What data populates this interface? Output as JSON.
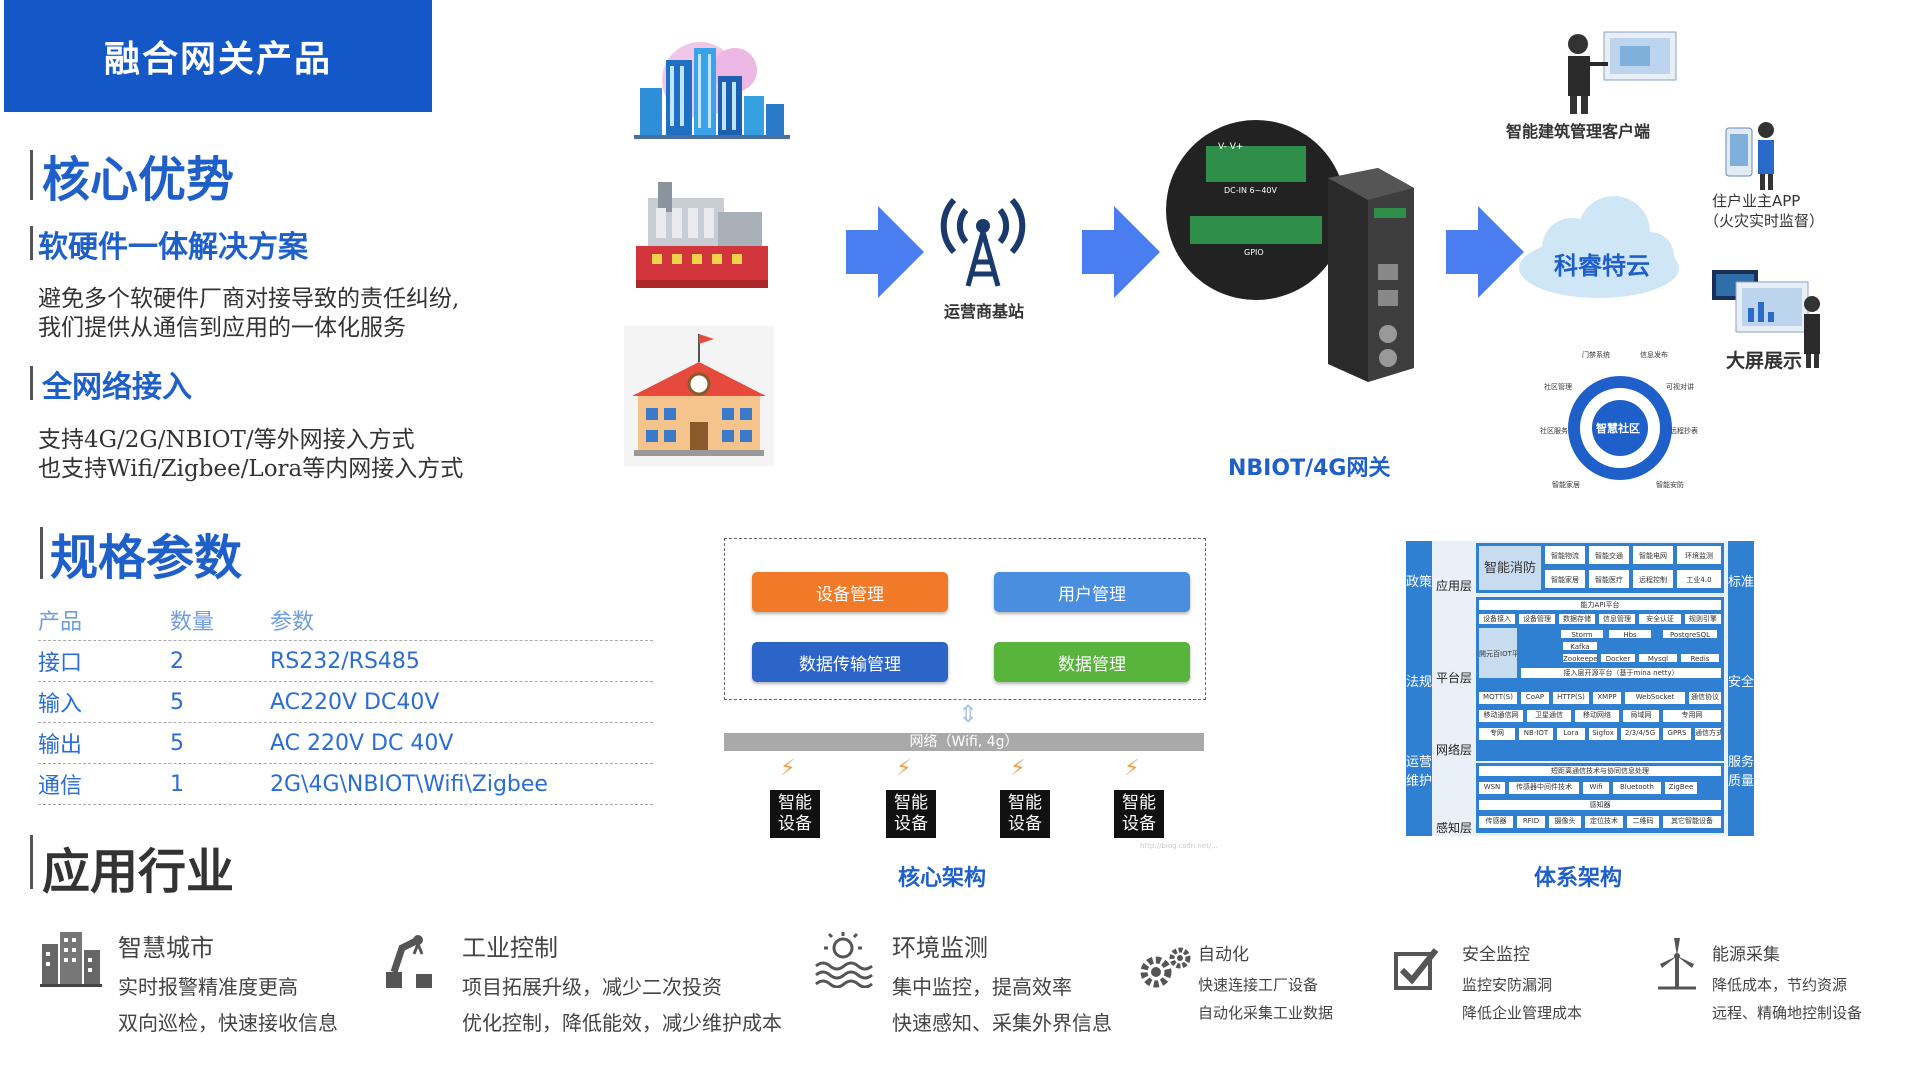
{
  "header": {
    "title": "融合网关产品"
  },
  "core_adv": {
    "heading": "核心优势",
    "sec1_title": "软硬件一体解决方案",
    "sec1_lines": [
      "避免多个软硬件厂商对接导致的责任纠纷,",
      "我们提供从通信到应用的一体化服务"
    ],
    "sec2_title": "全网络接入",
    "sec2_lines": [
      "支持4G/2G/NBIOT/等外网接入方式",
      "也支持Wifi/Zigbee/Lora等内网接入方式"
    ]
  },
  "spec": {
    "heading": "规格参数",
    "headers": [
      "产品",
      "数量",
      "参数"
    ],
    "rows": [
      [
        "接口",
        "2",
        "RS232/RS485"
      ],
      [
        "输入",
        "5",
        "AC220V DC40V"
      ],
      [
        "输出",
        "5",
        "AC 220V DC 40V"
      ],
      [
        "通信",
        "1",
        "2G\\4G\\NBIOT\\Wifi\\Zigbee"
      ]
    ]
  },
  "industries": {
    "heading": "应用行业",
    "items": [
      {
        "title": "智慧城市",
        "lines": [
          "实时报警精准度更高",
          "双向巡检，快速接收信息"
        ],
        "icon": "city-building-icon"
      },
      {
        "title": "工业控制",
        "lines": [
          "项目拓展升级，减少二次投资",
          "优化控制，降低能效，减少维护成本"
        ],
        "icon": "robot-arm-icon"
      },
      {
        "title": "环境监测",
        "lines": [
          "集中监控，提高效率",
          "快速感知、采集外界信息"
        ],
        "icon": "water-sun-icon"
      },
      {
        "title": "自动化",
        "lines": [
          "快速连接工厂设备",
          "自动化采集工业数据"
        ],
        "icon": "gears-icon"
      },
      {
        "title": "安全监控",
        "lines": [
          "监控安防漏洞",
          "降低企业管理成本"
        ],
        "icon": "check-shield-icon"
      },
      {
        "title": "能源采集",
        "lines": [
          "降低成本，节约资源",
          "远程、精确地控制设备"
        ],
        "icon": "wind-turbine-icon"
      }
    ]
  },
  "topology": {
    "tower_label": "运营商基站",
    "gateway_label": "NBIOT/4G网关",
    "cloud_label": "科睿特云",
    "client_label": "智能建筑管理客户端",
    "app_label_1": "住户业主APP",
    "app_label_2": "（火灾实时监督）",
    "screen_label": "大屏展示",
    "community_center": "智慧社区",
    "community_items": [
      "门禁系统",
      "信息发布",
      "可视对讲",
      "远程抄表",
      "智能安防",
      "智能家居",
      "社区服务",
      "社区管理"
    ],
    "terminal_top": "V-  V+",
    "terminal_dc": "DC-IN 6~40V",
    "terminal_gpio": "GPIO"
  },
  "core_arch": {
    "caption": "核心架构",
    "modules": [
      {
        "label": "设备管理",
        "color": "#f07a28"
      },
      {
        "label": "用户管理",
        "color": "#4a8ee0"
      },
      {
        "label": "数据传输管理",
        "color": "#2c64c8"
      },
      {
        "label": "数据管理",
        "color": "#58b43a"
      }
    ],
    "network_label": "网络（Wifi, 4g）",
    "device_label": "智能设备",
    "watermark": "http://blog.csdn.net/..."
  },
  "sys_arch": {
    "caption": "体系架构",
    "left_col": [
      "政策",
      "法规",
      "运营维护"
    ],
    "right_col": [
      "标准",
      "安全",
      "服务质量"
    ],
    "layers": [
      "应用层",
      "平台层",
      "网络层",
      "感知层"
    ],
    "app_title": "智能消防",
    "app_cells": [
      "智能物流",
      "智能交通",
      "智能电网",
      "环境监测",
      "智能家居",
      "智能医疗",
      "远程控制",
      "工业4.0"
    ],
    "platform_cells": [
      "能力API平台",
      "设备接入",
      "设备管理",
      "数据存储",
      "信息管理",
      "安全认证",
      "规则引擎"
    ],
    "platform_title": "開元百IOT平台",
    "tech_cells": [
      "Storm",
      "Hbs",
      "Kafka",
      "Zookeeper",
      "Docker",
      "Mysql",
      "Redis",
      "PostgreSQL"
    ],
    "access_cell": "接入层开源平台（基于mina netty）",
    "net_cells": [
      "MQTT(S)",
      "CoAP",
      "HTTP(S)",
      "XMPP",
      "WebSocket",
      "通信协议",
      "移动通信网",
      "卫星通信",
      "移动网络",
      "局域网",
      "专用网",
      "专网",
      "NB-IOT",
      "Lora",
      "Sigfox",
      "2/3/4/5G",
      "GPRS",
      "通信方式"
    ],
    "sense_cells": [
      "短距离通信技术与协同信息处理",
      "WSN",
      "传感器中间件技术",
      "Wifi",
      "Bluetooth",
      "ZigBee",
      "感知器",
      "传感器",
      "RFID",
      "摄像头",
      "定位技术",
      "二维码",
      "其它智能设备"
    ]
  }
}
